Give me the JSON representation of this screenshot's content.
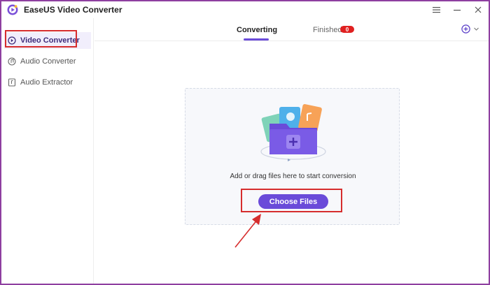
{
  "window": {
    "title": "EaseUS Video Converter"
  },
  "sidebar": {
    "items": [
      {
        "label": "Video Converter",
        "icon": "video-converter-icon",
        "active": true
      },
      {
        "label": "Audio Converter",
        "icon": "audio-converter-icon",
        "active": false
      },
      {
        "label": "Audio Extractor",
        "icon": "audio-extractor-icon",
        "active": false
      }
    ]
  },
  "tabs": [
    {
      "label": "Converting",
      "active": true
    },
    {
      "label": "Finished",
      "active": false,
      "badge": "0"
    }
  ],
  "drop_zone": {
    "hint": "Add or drag files here to start conversion",
    "button_label": "Choose Files"
  },
  "colors": {
    "accent": "#6a4bd9",
    "frame": "#8e3fa0",
    "highlight": "#d62d2d",
    "badge": "#e02020"
  }
}
